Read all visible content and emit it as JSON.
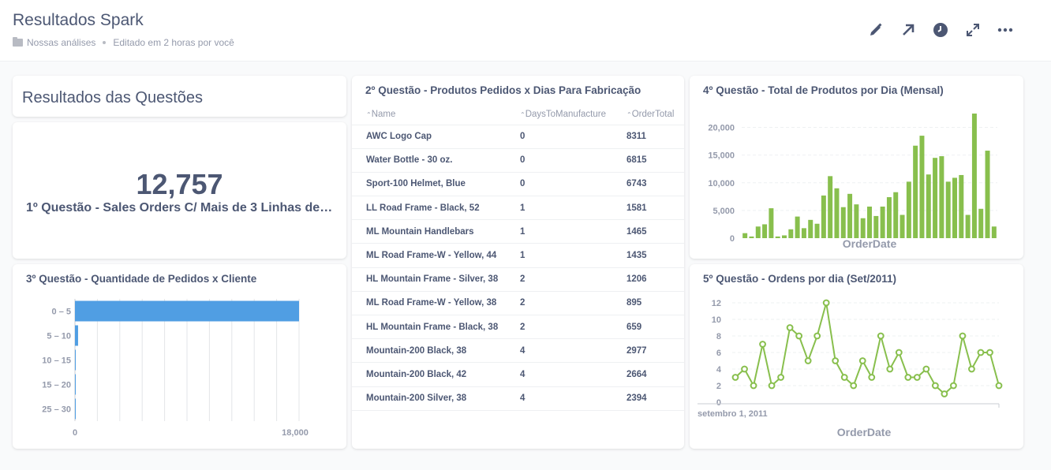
{
  "header": {
    "title": "Resultados Spark",
    "collection": "Nossas análises",
    "edited": "Editado em 2 horas por você",
    "tools": [
      "pencil-icon",
      "share-arrow-icon",
      "clock-icon",
      "fullscreen-icon",
      "more-icon"
    ]
  },
  "heading_card": {
    "text": "Resultados das Questões"
  },
  "q1": {
    "value": "12,757",
    "label": "1º Questão - Sales Orders C/ Mais de 3 Linhas de De..."
  },
  "q2": {
    "title": "2º Questão - Produtos Pedidos x Dias Para Fabricação",
    "columns": [
      "Name",
      "DaysToManufacture",
      "OrderTotal"
    ],
    "rows": [
      [
        "AWC Logo Cap",
        "0",
        "8311"
      ],
      [
        "Water Bottle - 30 oz.",
        "0",
        "6815"
      ],
      [
        "Sport-100 Helmet, Blue",
        "0",
        "6743"
      ],
      [
        "LL Road Frame - Black, 52",
        "1",
        "1581"
      ],
      [
        "ML Mountain Handlebars",
        "1",
        "1465"
      ],
      [
        "ML Road Frame-W - Yellow, 44",
        "1",
        "1435"
      ],
      [
        "HL Mountain Frame - Silver, 38",
        "2",
        "1206"
      ],
      [
        "ML Road Frame-W - Yellow, 38",
        "2",
        "895"
      ],
      [
        "HL Mountain Frame - Black, 38",
        "2",
        "659"
      ],
      [
        "Mountain-200 Black, 38",
        "4",
        "2977"
      ],
      [
        "Mountain-200 Black, 42",
        "4",
        "2664"
      ],
      [
        "Mountain-200 Silver, 38",
        "4",
        "2394"
      ]
    ]
  },
  "colors": {
    "blue": "#509ee3",
    "green": "#88bf4d",
    "text": "#4c5773",
    "muted": "#949aab"
  },
  "chart_data": [
    {
      "id": "q3",
      "type": "bar",
      "orientation": "horizontal",
      "title": "3º Questão - Quantidade de Pedidos x Cliente",
      "categories": [
        "0 – 5",
        "5 – 10",
        "10 – 15",
        "15 – 20",
        "25 – 30"
      ],
      "values": [
        18000,
        250,
        60,
        12,
        4
      ],
      "xticks": [
        "0",
        "18,000"
      ],
      "xlim": [
        0,
        18000
      ]
    },
    {
      "id": "q4",
      "type": "bar",
      "title": "4º Questão - Total de Produtos por Dia (Mensal)",
      "xlabel": "OrderDate",
      "yticks": [
        "0",
        "5,000",
        "10,000",
        "15,000",
        "20,000"
      ],
      "ylim": [
        0,
        22500
      ],
      "values": [
        900,
        300,
        2100,
        2500,
        5400,
        300,
        500,
        1600,
        3900,
        1800,
        3300,
        2600,
        7700,
        11200,
        9000,
        5600,
        8000,
        6100,
        3600,
        5700,
        4000,
        5700,
        7400,
        8300,
        4200,
        10200,
        16700,
        18500,
        11500,
        14500,
        14800,
        10200,
        10900,
        11400,
        4200,
        22500,
        5300,
        15800,
        2100
      ]
    },
    {
      "id": "q5",
      "type": "line",
      "title": "5º Questão - Ordens por dia (Set/2011)",
      "xlabel": "OrderDate",
      "xtick": "setembro 1, 2011",
      "yticks": [
        "0",
        "2",
        "4",
        "6",
        "8",
        "10",
        "12"
      ],
      "ylim": [
        0,
        12
      ],
      "values": [
        3,
        4,
        2,
        7,
        2,
        3,
        9,
        8,
        5,
        8,
        12,
        5,
        3,
        2,
        5,
        3,
        8,
        4,
        6,
        3,
        3,
        4,
        2,
        1,
        2,
        8,
        4,
        6,
        6,
        2
      ]
    }
  ]
}
